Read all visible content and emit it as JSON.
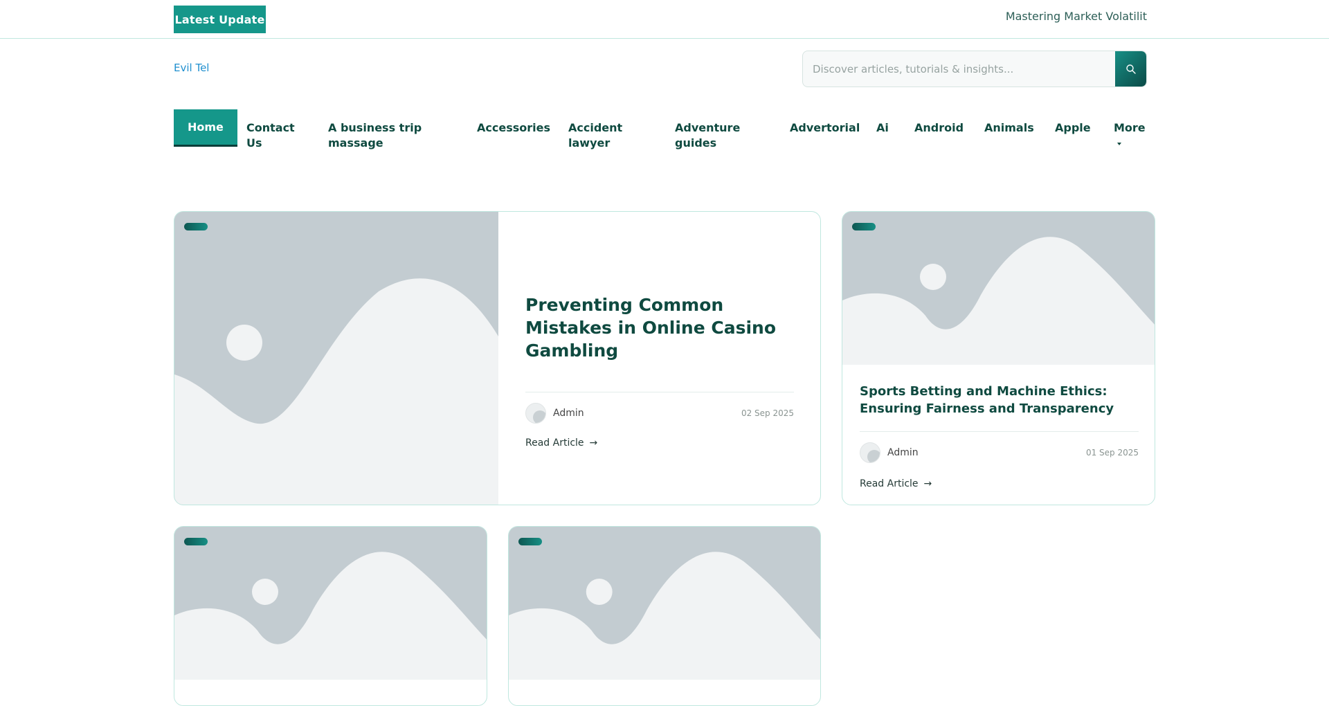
{
  "topbar": {
    "badge": "Latest Update",
    "ticker": "Mastering Market Volatilit"
  },
  "brand": "Evil Tel",
  "search": {
    "placeholder": "Discover articles, tutorials & insights..."
  },
  "nav": {
    "items": [
      {
        "label": "Home"
      },
      {
        "label": "Contact Us"
      },
      {
        "label": "A business trip massage"
      },
      {
        "label": "Accessories"
      },
      {
        "label": "Accident lawyer"
      },
      {
        "label": "Adventure guides"
      },
      {
        "label": "Advertorial"
      },
      {
        "label": "Ai"
      },
      {
        "label": "Android"
      },
      {
        "label": "Animals"
      },
      {
        "label": "Apple"
      },
      {
        "label": "More"
      }
    ]
  },
  "posts": [
    {
      "title": "Preventing Common Mistakes in Online Casino Gambling",
      "author": "Admin",
      "date": "02 Sep 2025",
      "read": "Read Article",
      "arrow": "→"
    },
    {
      "title": "Sports Betting and Machine Ethics: Ensuring Fairness and Transparency",
      "author": "Admin",
      "date": "01 Sep 2025",
      "read": "Read Article",
      "arrow": "→"
    }
  ]
}
